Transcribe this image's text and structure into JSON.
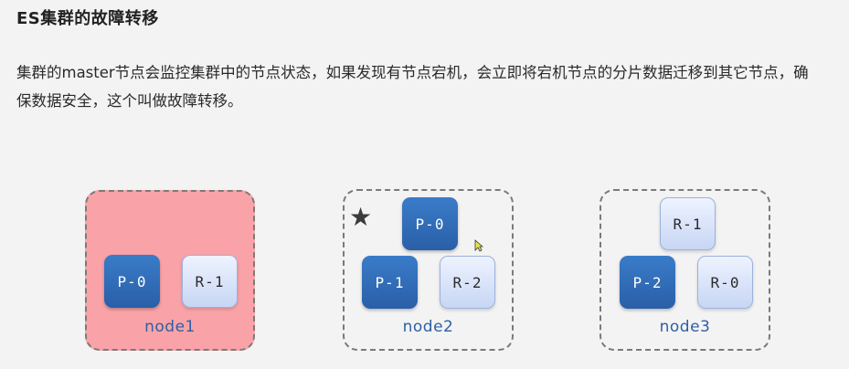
{
  "title": "ES集群的故障转移",
  "description_line1": "集群的master节点会监控集群中的节点状态，如果发现有节点宕机，会立即将宕机节点的分片数据迁移到其它节点，确",
  "description_line2": "保数据安全，这个叫做故障转移。",
  "nodes": [
    {
      "name": "node1",
      "status": "down",
      "shards": [
        "P-0",
        "R-1"
      ]
    },
    {
      "name": "node2",
      "status": "master",
      "shards": [
        "P-0",
        "P-1",
        "R-2"
      ]
    },
    {
      "name": "node3",
      "status": "up",
      "shards": [
        "R-1",
        "P-2",
        "R-0"
      ]
    }
  ],
  "colors": {
    "down_node_fill": "#f9a3a8",
    "primary_shard": "#2f6bb5",
    "replica_shard": "#dbe5fb",
    "node_label": "#2e5fa3"
  },
  "icons": {
    "master_marker": "star-icon",
    "pointer": "cursor-icon"
  }
}
